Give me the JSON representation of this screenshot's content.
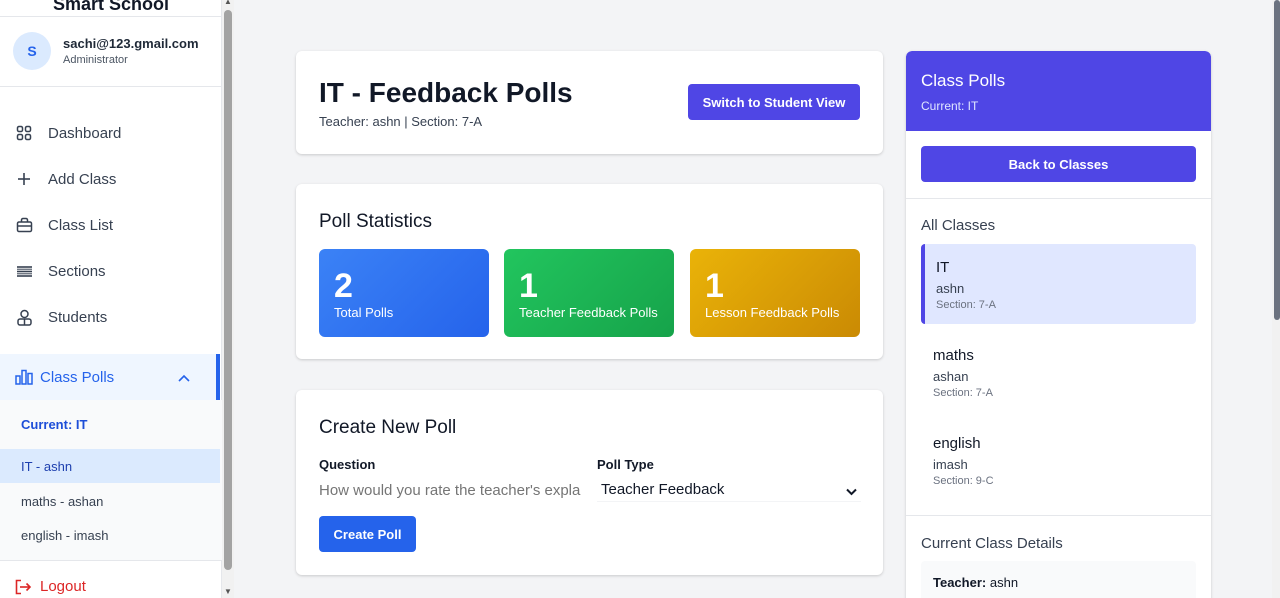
{
  "sidebar": {
    "brand": "Smart School",
    "user": {
      "initial": "S",
      "email": "sachi@123.gmail.com",
      "role": "Administrator"
    },
    "nav": [
      {
        "label": "Dashboard",
        "icon": "grid-icon"
      },
      {
        "label": "Add Class",
        "icon": "plus-icon"
      },
      {
        "label": "Class List",
        "icon": "briefcase-icon"
      },
      {
        "label": "Sections",
        "icon": "lines-icon"
      },
      {
        "label": "Students",
        "icon": "users-icon"
      }
    ],
    "polls": {
      "label": "Class Polls",
      "current": "Current: IT",
      "items": [
        "IT - ashn",
        "maths - ashan",
        "english - imash"
      ]
    },
    "logout": "Logout"
  },
  "header": {
    "title": "IT - Feedback Polls",
    "subtitle": "Teacher: ashn | Section: 7-A",
    "switch_label": "Switch to Student View"
  },
  "stats": {
    "title": "Poll Statistics",
    "items": [
      {
        "value": "2",
        "label": "Total Polls"
      },
      {
        "value": "1",
        "label": "Teacher Feedback Polls"
      },
      {
        "value": "1",
        "label": "Lesson Feedback Polls"
      }
    ]
  },
  "create": {
    "title": "Create New Poll",
    "question_label": "Question",
    "question_placeholder": "How would you rate the teacher's expla",
    "type_label": "Poll Type",
    "type_value": "Teacher Feedback",
    "button": "Create Poll"
  },
  "right_panel": {
    "title": "Class Polls",
    "current": "Current: IT",
    "back_label": "Back to Classes",
    "all_classes_label": "All Classes",
    "classes": [
      {
        "name": "IT",
        "teacher": "ashn",
        "section": "Section: 7-A"
      },
      {
        "name": "maths",
        "teacher": "ashan",
        "section": "Section: 7-A"
      },
      {
        "name": "english",
        "teacher": "imash",
        "section": "Section: 9-C"
      }
    ],
    "details_label": "Current Class Details",
    "teacher_key": "Teacher:",
    "teacher_value": "ashn"
  },
  "colors": {
    "primary": "#4f46e5",
    "blue": "#2563eb",
    "green": "#16a34a",
    "gold": "#ca8a04",
    "danger": "#dc2626"
  }
}
